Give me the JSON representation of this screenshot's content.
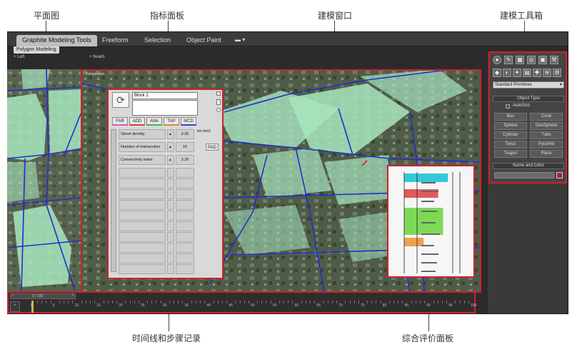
{
  "callouts": {
    "plan_view": "平面图",
    "indicator_panel": "指标面板",
    "modeling_window": "建模窗口",
    "modeling_toolbox": "建模工具箱",
    "timeline": "时间线和步骤记录",
    "evaluation_panel": "综合评价面板"
  },
  "ribbon": {
    "tabs": [
      "Graphite Modeling Tools",
      "Freeform",
      "Selection",
      "Object Paint"
    ],
    "subtab": "Polygon Modeling"
  },
  "viewports": {
    "left_label": "+ Left",
    "main_label": "+ Nearb",
    "perspective_label": "Perspective"
  },
  "indicator_panel": {
    "block_name": "Block 1",
    "category_buttons": [
      "FAR",
      "ADD",
      "ANA",
      "TAP",
      "MCD"
    ],
    "category_colors": [
      "#d957c6",
      "#d93b3b",
      "#3fb84a",
      "#e08a2a",
      "#3a3ad0"
    ],
    "rows": [
      {
        "label": "Street density",
        "value": "3.36",
        "unit": "km /km2"
      },
      {
        "label": "Number of intersection",
        "value": "15",
        "unit": "PAD"
      },
      {
        "label": "Connectivity index",
        "value": "3.26",
        "unit": ""
      }
    ],
    "empty_rows": 10
  },
  "toolbox": {
    "dropdown": "Standard Primitives",
    "object_type_title": "Object Type",
    "autogrid": "AutoGrid",
    "primitives": [
      "Box",
      "Cone",
      "Sphere",
      "GeoSphere",
      "Cylinder",
      "Tube",
      "Torus",
      "Pyramid",
      "Teapot",
      "Plane"
    ],
    "name_color_title": "Name and Color"
  },
  "timeline": {
    "frame_counter": "0 / 100",
    "ticks": [
      "0",
      "5",
      "10",
      "15",
      "20",
      "25",
      "30",
      "35",
      "40",
      "45",
      "50",
      "55",
      "60",
      "65",
      "70",
      "75",
      "80",
      "85",
      "90",
      "95",
      "100"
    ]
  },
  "evaluation_panel": {
    "bands": [
      {
        "color": "#35c7d8",
        "fill": 0.9
      },
      {
        "color": "#e05a5a",
        "fill": 0.7
      },
      {
        "color": "#7ed957",
        "fill": 0.8
      },
      {
        "color": "#f0a050",
        "fill": 0.4
      }
    ]
  }
}
